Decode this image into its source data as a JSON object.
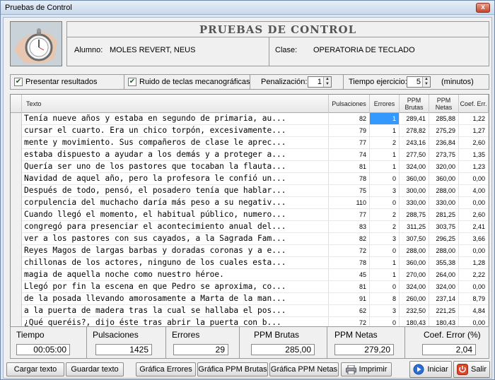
{
  "window": {
    "title": "Pruebas de Control",
    "close_glyph": "x"
  },
  "header": {
    "title": "PRUEBAS DE CONTROL",
    "student_label": "Alumno:",
    "student_value": "MOLES REVERT, NEUS",
    "class_label": "Clase:",
    "class_value": "OPERATORIA DE TECLADO",
    "image_icon": "stopwatch-icon"
  },
  "options": {
    "show_results_label": "Presentar resultados",
    "show_results_checked": true,
    "key_noise_label": "Ruido de teclas mecanográficas",
    "key_noise_checked": true,
    "penalty_label": "Penalización:",
    "penalty_value": "1",
    "time_label": "Tiempo ejercicio:",
    "time_value": "5",
    "time_unit": "(minutos)"
  },
  "table": {
    "columns": [
      "Texto",
      "Pulsaciones",
      "Errores",
      "PPM\nBrutas",
      "PPM\nNetas",
      "Coef. Err."
    ],
    "rows": [
      [
        "Tenía nueve años y estaba en segundo de primaria, au...",
        "82",
        "1",
        "289,41",
        "285,88",
        "1,22"
      ],
      [
        "cursar el cuarto. Era un chico torpón, excesivamente...",
        "79",
        "1",
        "278,82",
        "275,29",
        "1,27"
      ],
      [
        "mente y movimiento. Sus compañeros de clase le aprec...",
        "77",
        "2",
        "243,16",
        "236,84",
        "2,60"
      ],
      [
        "estaba dispuesto a ayudar a los demás y a proteger a...",
        "74",
        "1",
        "277,50",
        "273,75",
        "1,35"
      ],
      [
        "Quería ser uno de los pastores que tocaban la flauta...",
        "81",
        "1",
        "324,00",
        "320,00",
        "1,23"
      ],
      [
        "Navidad de aquel año, pero la profesora le confió un...",
        "78",
        "0",
        "360,00",
        "360,00",
        "0,00"
      ],
      [
        "Después de todo, pensó, el posadero tenía que hablar...",
        "75",
        "3",
        "300,00",
        "288,00",
        "4,00"
      ],
      [
        "corpulencia del muchacho daría más peso a su negativ...",
        "110",
        "0",
        "330,00",
        "330,00",
        "0,00"
      ],
      [
        "Cuando llegó el momento, el habitual público, numero...",
        "77",
        "2",
        "288,75",
        "281,25",
        "2,60"
      ],
      [
        "congregó para presenciar el acontecimiento anual del...",
        "83",
        "2",
        "311,25",
        "303,75",
        "2,41"
      ],
      [
        "ver a los pastores con sus cayados, a la Sagrada Fam...",
        "82",
        "3",
        "307,50",
        "296,25",
        "3,66"
      ],
      [
        "Reyes Magos de largas barbas y doradas coronas y a e...",
        "72",
        "0",
        "288,00",
        "288,00",
        "0,00"
      ],
      [
        "chillonas de los actores, ninguno de los cuales esta...",
        "78",
        "1",
        "360,00",
        "355,38",
        "1,28"
      ],
      [
        "magia de aquella noche como nuestro héroe.",
        "45",
        "1",
        "270,00",
        "264,00",
        "2,22"
      ],
      [
        "Llegó por fin la escena en que Pedro se aproxima, co...",
        "81",
        "0",
        "324,00",
        "324,00",
        "0,00"
      ],
      [
        "de la posada llevando amorosamente a Marta de la man...",
        "91",
        "8",
        "260,00",
        "237,14",
        "8,79"
      ],
      [
        "a la puerta de madera tras la cual se hallaba el pos...",
        "62",
        "3",
        "232,50",
        "221,25",
        "4,84"
      ],
      [
        "¿Qué queréis?, dijo éste tras abrir la puerta con b...",
        "72",
        "0",
        "180,43",
        "180,43",
        "0,00"
      ]
    ]
  },
  "summary": {
    "time_label": "Tiempo",
    "time_value": "00:05:00",
    "keystrokes_label": "Pulsaciones",
    "keystrokes_value": "1425",
    "errors_label": "Errores",
    "errors_value": "29",
    "gross_label": "PPM Brutas",
    "gross_value": "285,00",
    "net_label": "PPM Netas",
    "net_value": "279,20",
    "coef_label": "Coef. Error (%)",
    "coef_value": "2,04"
  },
  "buttons": {
    "load_text": "Cargar texto",
    "save_text": "Guardar texto",
    "chart_errors": "Gráfica Errores",
    "chart_gross": "Gráfica PPM Brutas",
    "chart_net": "Gráfica PPM Netas",
    "print": "Imprimir",
    "start": "Iniciar",
    "exit": "Salir"
  },
  "colors": {
    "selection": "#3399ff",
    "start_icon": "#2a6fd6",
    "exit_icon": "#e0452a"
  }
}
